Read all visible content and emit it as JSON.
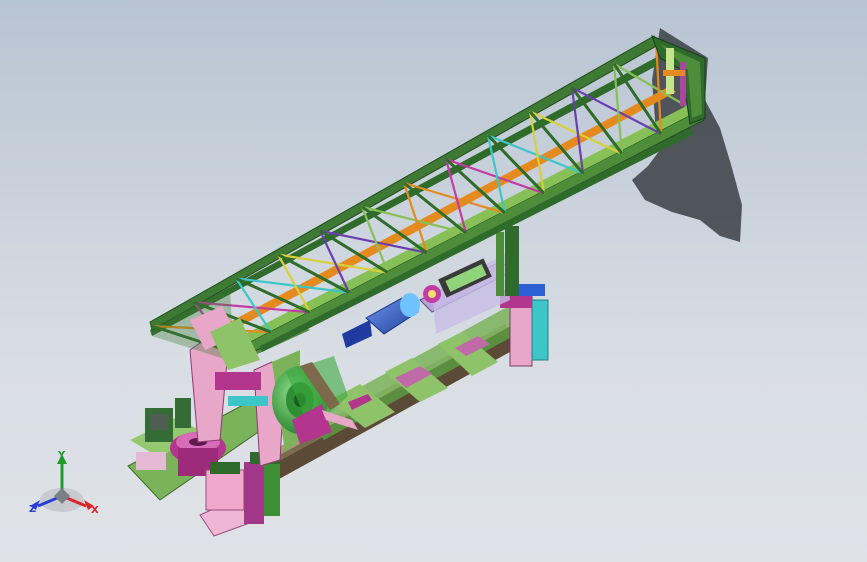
{
  "app": {
    "view_type": "isometric-3d-cad-viewport",
    "background_colors": [
      "#b7c4d2",
      "#d9dee4",
      "#dfe3e8"
    ]
  },
  "model": {
    "subject": "truss-jib-crane-on-rail-base",
    "colors": {
      "truss_dark": "#2f6b2a",
      "truss_mid": "#4e8e3b",
      "truss_light": "#86c057",
      "brace_orange": "#e58a1f",
      "brace_magenta": "#c23ca4",
      "brace_cyan": "#3cc6c8",
      "brace_yellow": "#d8cf3a",
      "brace_purple": "#6a3fb0",
      "rail_brown": "#5a4a36",
      "rail_light": "#a79a78",
      "base_green": "#7ab35a",
      "pink": "#e8a7c9",
      "magenta": "#b4358e",
      "motor_blue": "#2c5fd3",
      "drum_green": "#3ba83d",
      "shadow": "#3a3f44"
    }
  },
  "triad": {
    "labels": {
      "x": "X",
      "y": "Y",
      "z": "Z"
    },
    "colors": {
      "x": "#d8262b",
      "y": "#1f9d2a",
      "z": "#2a3fd6"
    }
  }
}
